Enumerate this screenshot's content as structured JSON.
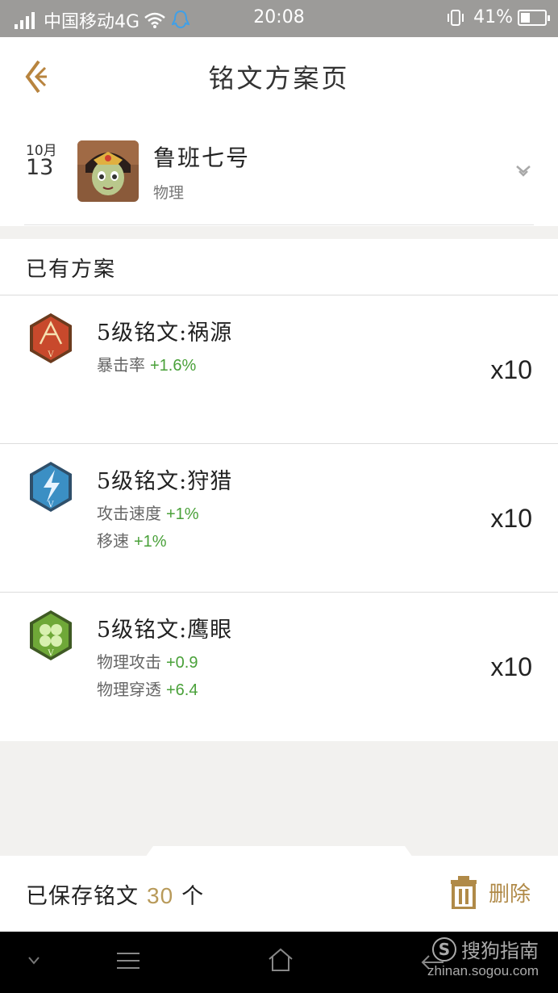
{
  "status_bar": {
    "carrier": "中国移动4G",
    "time": "20:08",
    "battery": "41%",
    "battery_level": 0.41
  },
  "header": {
    "title": "铭文方案页"
  },
  "hero": {
    "month": "10月",
    "day": "13",
    "name": "鲁班七号",
    "type": "物理"
  },
  "section": {
    "title": "已有方案"
  },
  "runes": [
    {
      "name": "5级铭文:祸源",
      "color": "#c8492c",
      "icon": "rune-red-icon",
      "attrs": [
        {
          "label": "暴击率",
          "value": "+1.6%"
        }
      ],
      "count": "x10"
    },
    {
      "name": "5级铭文:狩猎",
      "color": "#3b8fc4",
      "icon": "rune-blue-icon",
      "attrs": [
        {
          "label": "攻击速度",
          "value": "+1%"
        },
        {
          "label": "移速",
          "value": "+1%"
        }
      ],
      "count": "x10"
    },
    {
      "name": "5级铭文:鹰眼",
      "color": "#6fa838",
      "icon": "rune-green-icon",
      "attrs": [
        {
          "label": "物理攻击",
          "value": "+0.9"
        },
        {
          "label": "物理穿透",
          "value": "+6.4"
        }
      ],
      "count": "x10"
    }
  ],
  "footer": {
    "saved_prefix": "已保存铭文",
    "saved_count": "30",
    "saved_suffix": "个",
    "delete_label": "删除"
  },
  "watermark": {
    "brand": "搜狗指南",
    "s": "S",
    "url": "zhinan.sogou.com"
  }
}
